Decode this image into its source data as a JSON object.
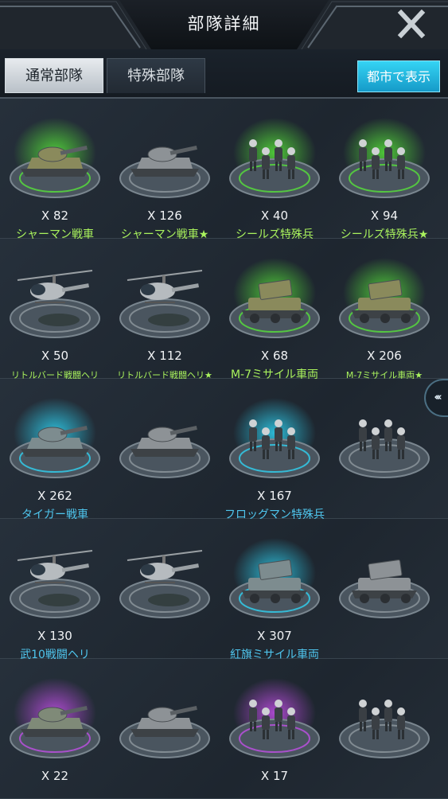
{
  "header": {
    "title": "部隊詳細"
  },
  "tabs": [
    {
      "label": "通常部隊",
      "active": true
    },
    {
      "label": "特殊部隊",
      "active": false
    }
  ],
  "city_button": "都市で表示",
  "side_handle": "‹‹‹",
  "colors": {
    "accent": "#2ab9e6",
    "green_label": "#a9f25d",
    "blue_label": "#4fc6ee",
    "purple_glow": "#b03fd9"
  },
  "units": [
    [
      {
        "count": "X 82",
        "name": "シャーマン戦車",
        "label_color": "green",
        "glow": "green",
        "icon": "tank-icon"
      },
      {
        "count": "X 126",
        "name": "シャーマン戦車★",
        "label_color": "green",
        "glow": "none",
        "icon": "tank-icon"
      },
      {
        "count": "X 40",
        "name": "シールズ特殊兵",
        "label_color": "green",
        "glow": "green",
        "icon": "soldiers-icon"
      },
      {
        "count": "X 94",
        "name": "シールズ特殊兵★",
        "label_color": "green",
        "glow": "green",
        "icon": "soldiers-icon"
      }
    ],
    [
      {
        "count": "X 50",
        "name": "リトルバード戦闘ヘリ",
        "label_color": "green",
        "glow": "none",
        "icon": "helicopter-icon"
      },
      {
        "count": "X 112",
        "name": "リトルバード戦闘ヘリ★",
        "label_color": "green",
        "glow": "none",
        "icon": "helicopter-icon"
      },
      {
        "count": "X 68",
        "name": "M-7ミサイル車両",
        "label_color": "green",
        "glow": "green",
        "icon": "missile-vehicle-icon"
      },
      {
        "count": "X 206",
        "name": "M-7ミサイル車両★",
        "label_color": "green",
        "glow": "green",
        "icon": "missile-vehicle-icon"
      }
    ],
    [
      {
        "count": "X 262",
        "name": "タイガー戦車",
        "label_color": "blue",
        "glow": "blue",
        "icon": "tank-icon"
      },
      {
        "count": "",
        "name": "",
        "label_color": "blue",
        "glow": "none",
        "icon": "tank-icon"
      },
      {
        "count": "X 167",
        "name": "フロッグマン特殊兵",
        "label_color": "blue",
        "glow": "blue",
        "icon": "soldiers-icon"
      },
      {
        "count": "",
        "name": "",
        "label_color": "blue",
        "glow": "none",
        "icon": "soldiers-icon"
      }
    ],
    [
      {
        "count": "X 130",
        "name": "武10戦闘ヘリ",
        "label_color": "blue",
        "glow": "none",
        "icon": "helicopter-icon"
      },
      {
        "count": "",
        "name": "",
        "label_color": "blue",
        "glow": "none",
        "icon": "helicopter-icon"
      },
      {
        "count": "X 307",
        "name": "紅旗ミサイル車両",
        "label_color": "blue",
        "glow": "blue",
        "icon": "missile-vehicle-icon"
      },
      {
        "count": "",
        "name": "",
        "label_color": "blue",
        "glow": "none",
        "icon": "missile-vehicle-icon"
      }
    ],
    [
      {
        "count": "X 22",
        "name": "",
        "label_color": "blue",
        "glow": "purple",
        "icon": "tank-icon"
      },
      {
        "count": "",
        "name": "",
        "label_color": "blue",
        "glow": "none",
        "icon": "tank-icon"
      },
      {
        "count": "X 17",
        "name": "",
        "label_color": "blue",
        "glow": "purple",
        "icon": "soldiers-icon"
      },
      {
        "count": "",
        "name": "",
        "label_color": "blue",
        "glow": "none",
        "icon": "soldiers-icon"
      }
    ]
  ]
}
